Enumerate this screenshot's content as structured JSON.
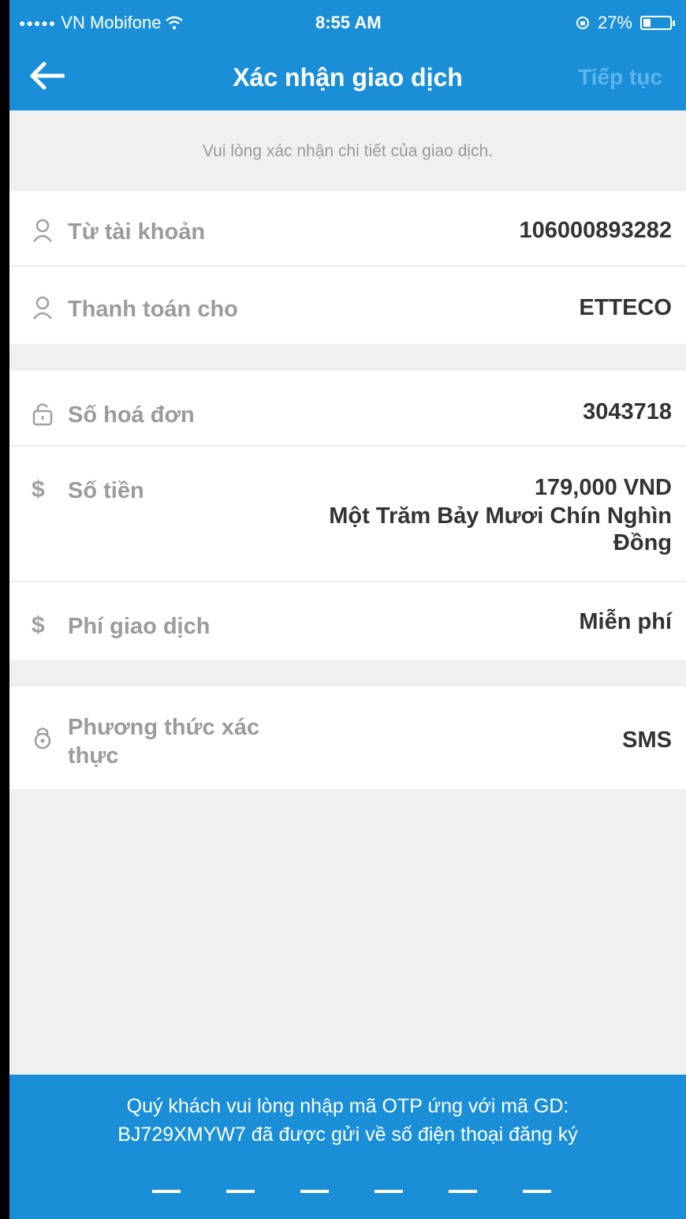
{
  "status_bar": {
    "carrier": "VN Mobifone",
    "time": "8:55 AM",
    "battery": "27%",
    "battery_level": 0.27
  },
  "nav": {
    "title": "Xác nhận giao dịch",
    "next_label": "Tiếp tục"
  },
  "hint": "Vui lòng xác nhận chi tiết của giao dịch.",
  "sections": [
    {
      "rows": [
        {
          "icon": "user-icon",
          "label": "Từ tài khoản",
          "value": "106000893282"
        },
        {
          "icon": "user-icon",
          "label": "Thanh toán cho",
          "value": "ETTECO"
        }
      ]
    },
    {
      "rows": [
        {
          "icon": "lock-icon",
          "label": "Số hoá đơn",
          "value": "3043718"
        },
        {
          "icon": "dollar-icon",
          "label": "Số tiền",
          "value": "179,000 VND",
          "value_words_1": "Một Trăm Bảy Mươi Chín Nghìn",
          "value_words_2": "Đồng"
        },
        {
          "icon": "dollar-icon",
          "label": "Phí giao dịch",
          "value": "Miễn phí"
        }
      ]
    },
    {
      "rows": [
        {
          "icon": "padlock-icon",
          "label_line1": "Phương thức xác",
          "label_line2": "thực",
          "value": "SMS"
        }
      ]
    }
  ],
  "otp": {
    "message_line1": "Quý khách vui lòng nhập mã OTP ứng với mã GD:",
    "message_line2": "BJ729XMYW7 đã được gửi về số điện thoại đăng ký",
    "digits": [
      "",
      "",
      "",
      "",
      "",
      ""
    ]
  }
}
